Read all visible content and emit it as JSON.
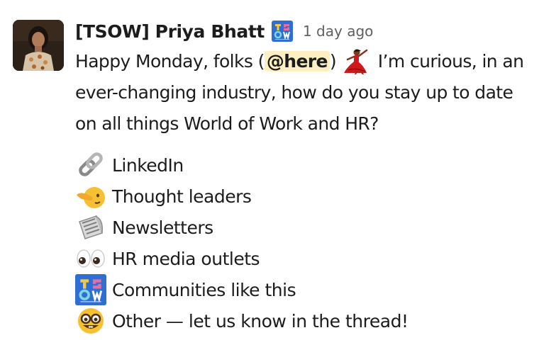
{
  "message": {
    "sender": "[TSOW] Priya Bhatt",
    "timestamp": "1 day ago",
    "text_before_mention": "Happy Monday, folks (",
    "mention": "@here",
    "text_after_mention": ")",
    "text_after_emoji": " I’m curious, in an ever-changing industry, how do you stay up to date on all things World of Work and HR?",
    "inline_emoji": "dancer-icon",
    "badge_icon": "tsow-logo-icon"
  },
  "options": [
    {
      "icon": "link-icon",
      "label": "LinkedIn"
    },
    {
      "icon": "pointing-face-icon",
      "label": "Thought leaders"
    },
    {
      "icon": "newspaper-icon",
      "label": "Newsletters"
    },
    {
      "icon": "eyes-icon",
      "label": "HR media outlets"
    },
    {
      "icon": "tsow-logo-icon",
      "label": "Communities like this"
    },
    {
      "icon": "nerd-face-icon",
      "label": "Other — let us know in the thread!"
    }
  ],
  "colors": {
    "mention_bg": "#fcefc2",
    "text": "#1d1c1d",
    "timestamp": "#616061",
    "tsow_blue": "#2f6fd3"
  }
}
